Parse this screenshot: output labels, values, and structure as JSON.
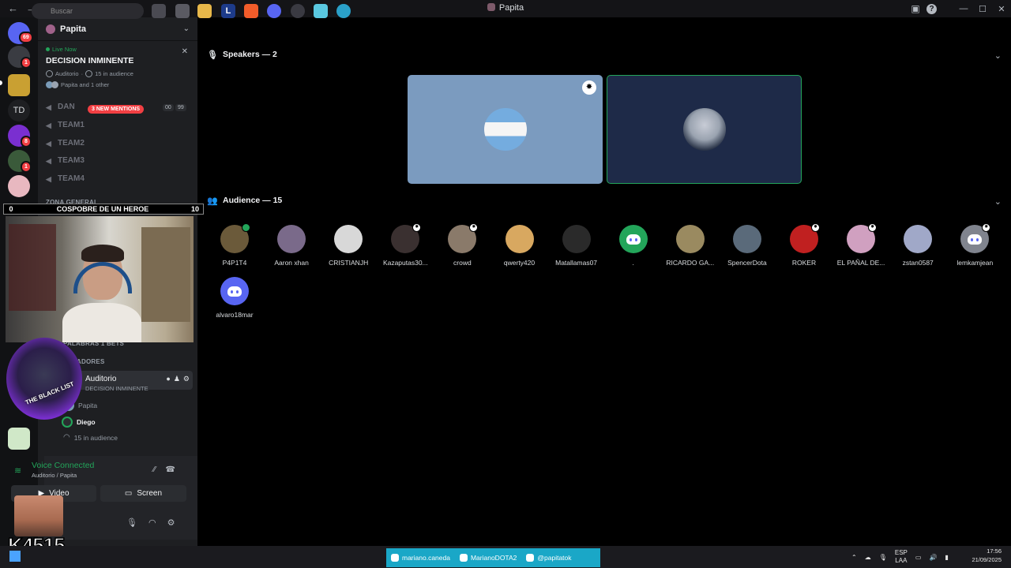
{
  "window": {
    "title": "Papita",
    "nav_back": "←",
    "nav_forward": "→",
    "min": "—",
    "max": "☐",
    "close": "✕",
    "help": "?"
  },
  "rail": {
    "badges": [
      "69",
      "1",
      "8",
      "1"
    ],
    "text_server": "TD"
  },
  "sidebar": {
    "server_name": "Papita",
    "live_now": "Live Now",
    "stage_title": "DECISION INMINENTE",
    "stage_meta_channel": "Auditorio",
    "stage_meta_audience": "15 in audience",
    "stage_speakers": "Papita and 1 other",
    "channels": [
      {
        "label": "DAN"
      },
      {
        "label": "TEAM1"
      },
      {
        "label": "TEAM2"
      },
      {
        "label": "TEAM3"
      },
      {
        "label": "TEAM4"
      }
    ],
    "mentions_pill": "3 NEW MENTIONS",
    "counter_a": "00",
    "counter_b": "99",
    "category_zona": "ZONA GENERAL",
    "category_apuestas": "PALABRAS 1 BETS",
    "category_jugadores": "JUGADORES",
    "voice_channel_name": "Auditorio",
    "voice_channel_sub": "DECISION INMINENTE",
    "members": [
      {
        "name": "Papita"
      },
      {
        "name": "Diego"
      }
    ],
    "audience_line": "15 in audience"
  },
  "voice_panel": {
    "status": "Voice Connected",
    "location": "Auditorio / Papita",
    "video_label": "Video",
    "screen_label": "Screen"
  },
  "stage": {
    "speakers_header": "Speakers — 2",
    "audience_header": "Audience — 15",
    "audience": [
      {
        "name": "P4P1T4",
        "color": "#6b5a3a",
        "badge": "online"
      },
      {
        "name": "Aaron xhan",
        "color": "#7a6a8a"
      },
      {
        "name": "CRISTIANJH",
        "color": "#d8d8d8"
      },
      {
        "name": "Kazaputas30...",
        "color": "#3a3030",
        "badge": "mod"
      },
      {
        "name": "crowd",
        "color": "#8a7a6a",
        "badge": "mod"
      },
      {
        "name": "qwerty420",
        "color": "#d8a860"
      },
      {
        "name": "Matallamas07",
        "color": "#2a2a2a"
      },
      {
        "name": ".",
        "color": "#23a55a",
        "discord": true
      },
      {
        "name": "RICARDO GA...",
        "color": "#9a8a60"
      },
      {
        "name": "SpencerDota",
        "color": "#5a6a7a"
      },
      {
        "name": "ROKER",
        "color": "#c02020",
        "badge": "mod"
      },
      {
        "name": "EL PAÑAL DE...",
        "color": "#d0a0c0",
        "badge": "mod"
      },
      {
        "name": "zstan0587",
        "color": "#a0a8c8"
      },
      {
        "name": "lemkamjean",
        "color": "#80848e",
        "discord": true,
        "badge": "mod"
      },
      {
        "name": "alvaro18mar",
        "color": "#5865f2",
        "discord": true
      }
    ]
  },
  "overlay": {
    "banner_left": "0",
    "banner_text": "COSPOBRE DE UN HEROE",
    "banner_right": "10",
    "wolf_text": "THE BLACK LIST",
    "big_text": "K4515"
  },
  "taskbar": {
    "search_placeholder": "Buscar",
    "socials": [
      {
        "label": "mariano.caneda"
      },
      {
        "label": "MarianoDOTA2"
      },
      {
        "label": "@papitatok"
      }
    ],
    "lang_top": "ESP",
    "lang_bottom": "LAA",
    "time": "17:56",
    "date": "21/09/2025"
  }
}
